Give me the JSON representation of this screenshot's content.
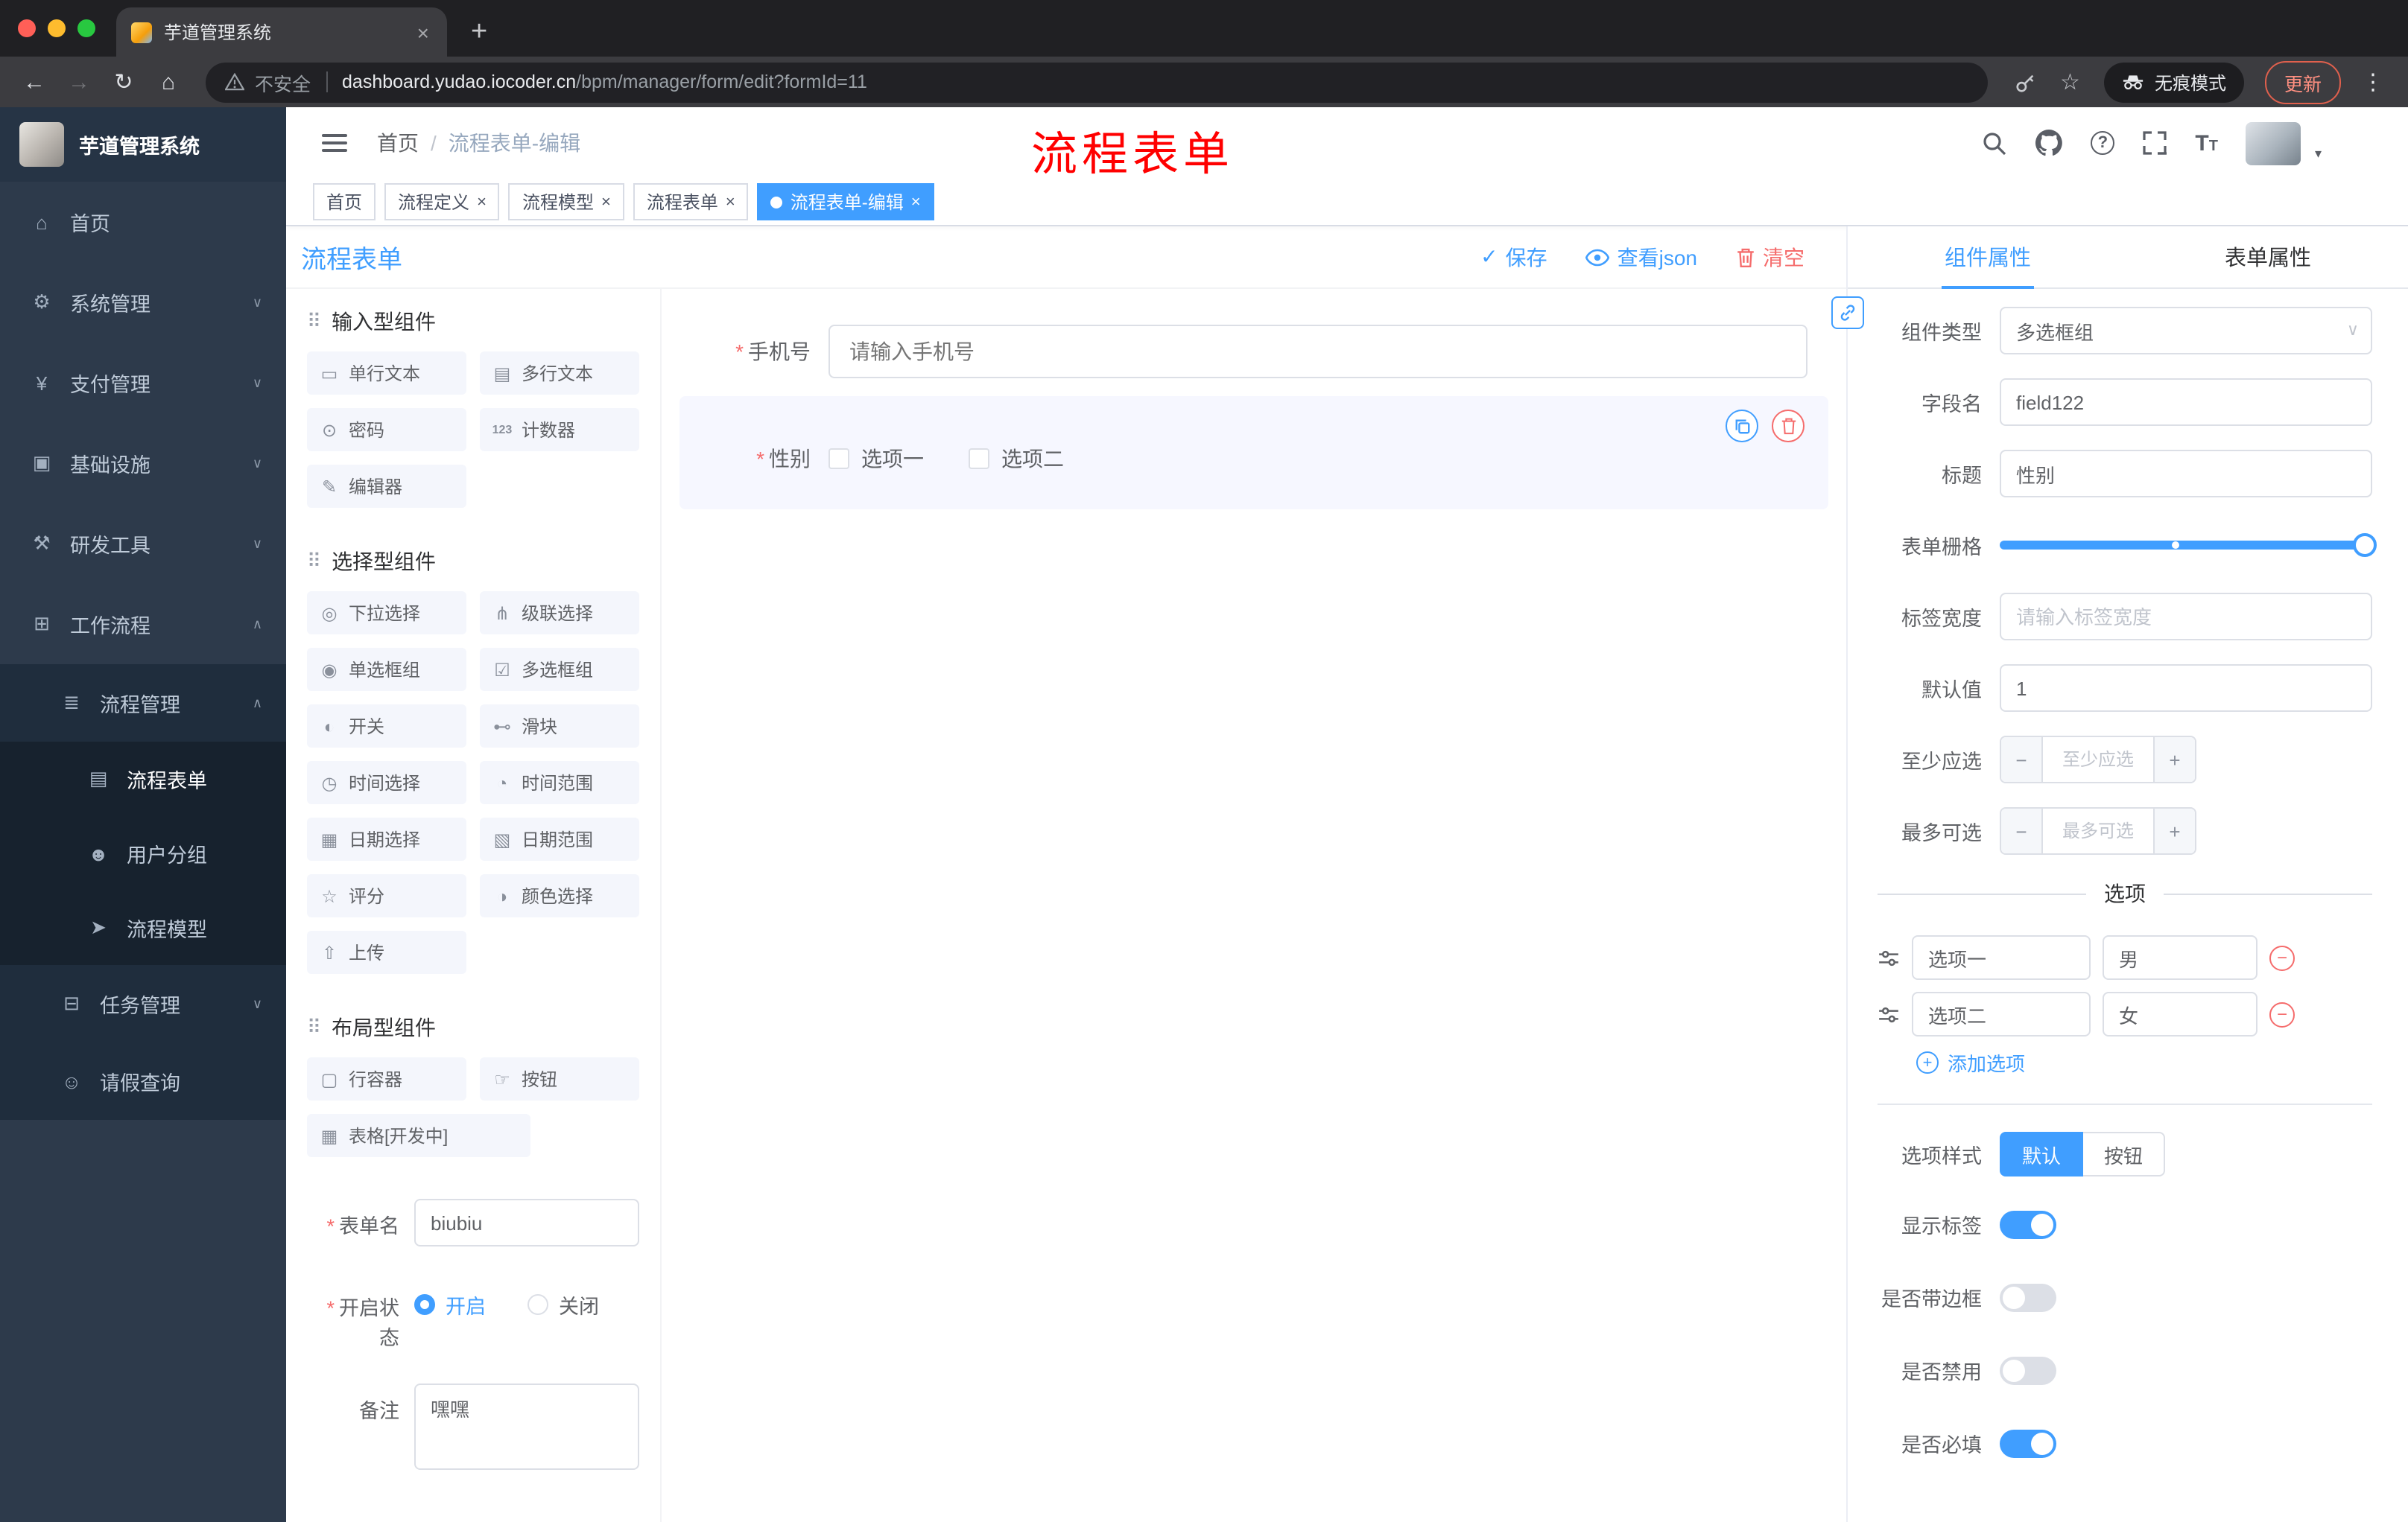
{
  "browser": {
    "tab_title": "芋道管理系统",
    "security_label": "不安全",
    "url_host": "dashboard.yudao.iocoder.cn",
    "url_path": "/bpm/manager/form/edit?formId=11",
    "incognito_label": "无痕模式",
    "update_label": "更新",
    "accent_colors": {
      "traffic_red": "#ff5f57",
      "traffic_yellow": "#febc2e",
      "traffic_green": "#28c840"
    }
  },
  "sidebar": {
    "logo_text": "芋道管理系统",
    "menu": [
      {
        "label": "首页",
        "icon": "home-icon"
      },
      {
        "label": "系统管理",
        "icon": "gear-icon"
      },
      {
        "label": "支付管理",
        "icon": "payment-icon"
      },
      {
        "label": "基础设施",
        "icon": "infrastructure-icon"
      },
      {
        "label": "研发工具",
        "icon": "devtools-icon"
      },
      {
        "label": "工作流程",
        "icon": "workflow-icon"
      }
    ],
    "process_mgmt_label": "流程管理",
    "process_children": [
      {
        "label": "流程表单",
        "active": true
      },
      {
        "label": "用户分组",
        "active": false
      },
      {
        "label": "流程模型",
        "active": false
      }
    ],
    "task_mgmt_label": "任务管理",
    "leave_query_label": "请假查询"
  },
  "header": {
    "breadcrumb_home": "首页",
    "breadcrumb_current": "流程表单-编辑",
    "annotation": "流程表单"
  },
  "tags": [
    {
      "label": "首页"
    },
    {
      "label": "流程定义"
    },
    {
      "label": "流程模型"
    },
    {
      "label": "流程表单"
    },
    {
      "label": "流程表单-编辑"
    }
  ],
  "designer": {
    "title": "流程表单",
    "save_label": "保存",
    "view_json_label": "查看json",
    "clear_label": "清空"
  },
  "palette": {
    "groups": [
      {
        "title": "输入型组件",
        "items": [
          {
            "label": "单行文本",
            "icon": "single-line-text-icon"
          },
          {
            "label": "多行文本",
            "icon": "textarea-icon"
          },
          {
            "label": "密码",
            "icon": "password-icon"
          },
          {
            "label": "计数器",
            "icon": "counter-icon"
          },
          {
            "label": "编辑器",
            "icon": "editor-icon"
          }
        ]
      },
      {
        "title": "选择型组件",
        "items": [
          {
            "label": "下拉选择",
            "icon": "select-icon"
          },
          {
            "label": "级联选择",
            "icon": "cascader-icon"
          },
          {
            "label": "单选框组",
            "icon": "radio-group-icon"
          },
          {
            "label": "多选框组",
            "icon": "checkbox-group-icon"
          },
          {
            "label": "开关",
            "icon": "switch-icon"
          },
          {
            "label": "滑块",
            "icon": "slider-icon"
          },
          {
            "label": "时间选择",
            "icon": "time-picker-icon"
          },
          {
            "label": "时间范围",
            "icon": "time-range-icon"
          },
          {
            "label": "日期选择",
            "icon": "date-picker-icon"
          },
          {
            "label": "日期范围",
            "icon": "date-range-icon"
          },
          {
            "label": "评分",
            "icon": "rate-icon"
          },
          {
            "label": "颜色选择",
            "icon": "color-picker-icon"
          },
          {
            "label": "上传",
            "icon": "upload-icon"
          }
        ]
      },
      {
        "title": "布局型组件",
        "items": [
          {
            "label": "行容器",
            "icon": "row-container-icon"
          },
          {
            "label": "按钮",
            "icon": "button-icon"
          },
          {
            "label": "表格[开发中]",
            "icon": "table-icon"
          }
        ]
      }
    ]
  },
  "meta": {
    "form_name_label": "表单名",
    "form_name_value": "biubiu",
    "status_label": "开启状态",
    "status_on": "开启",
    "status_off": "关闭",
    "remark_label": "备注",
    "remark_value": "嘿嘿"
  },
  "canvas": {
    "phone_label": "手机号",
    "phone_placeholder": "请输入手机号",
    "gender_label": "性别",
    "gender_option1": "选项一",
    "gender_option2": "选项二"
  },
  "props": {
    "tab_component": "组件属性",
    "tab_form": "表单属性",
    "component_type_label": "组件类型",
    "component_type_value": "多选框组",
    "field_name_label": "字段名",
    "field_name_value": "field122",
    "title_label": "标题",
    "title_value": "性别",
    "grid_label": "表单栅格",
    "label_width_label": "标签宽度",
    "label_width_placeholder": "请输入标签宽度",
    "default_label": "默认值",
    "default_value": "1",
    "min_label": "至少应选",
    "min_placeholder": "至少应选",
    "max_label": "最多可选",
    "max_placeholder": "最多可选",
    "options_divider": "选项",
    "options": [
      {
        "name": "选项一",
        "value": "男"
      },
      {
        "name": "选项二",
        "value": "女"
      }
    ],
    "add_option": "添加选项",
    "style_label": "选项样式",
    "style_default": "默认",
    "style_button": "按钮",
    "switch_show_label": "显示标签",
    "switch_border": "是否带边框",
    "switch_disabled": "是否禁用",
    "switch_required": "是否必填",
    "accent": "#409eff",
    "danger": "#f56c6c"
  }
}
